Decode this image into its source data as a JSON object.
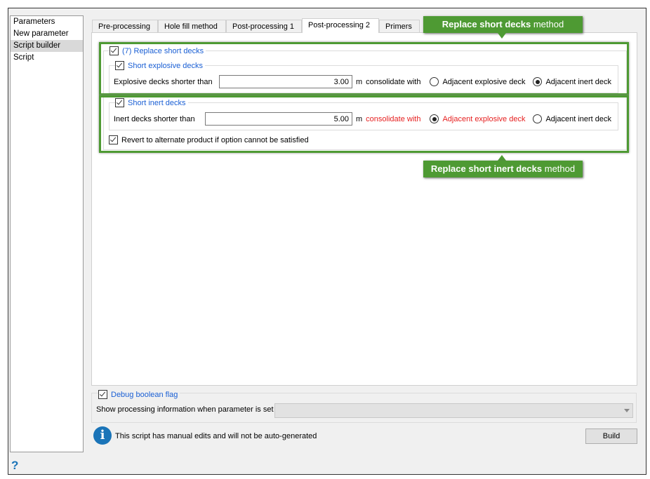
{
  "sidebar": {
    "items": [
      {
        "label": "Parameters"
      },
      {
        "label": "New parameter"
      },
      {
        "label": "Script builder"
      },
      {
        "label": "Script"
      }
    ]
  },
  "tabs": [
    {
      "label": "Pre-processing"
    },
    {
      "label": "Hole fill method"
    },
    {
      "label": "Post-processing 1"
    },
    {
      "label": "Post-processing 2"
    },
    {
      "label": "Primers"
    }
  ],
  "replace_group": {
    "label": "(7) Replace short decks"
  },
  "explosive": {
    "group_label": "Short explosive decks",
    "field_label": "Explosive decks shorter than",
    "value": "3.00",
    "unit": "m",
    "consolidate": "consolidate with",
    "opt1": "Adjacent explosive deck",
    "opt2": "Adjacent inert deck",
    "selected": "opt2"
  },
  "inert": {
    "group_label": "Short inert decks",
    "field_label": "Inert decks shorter than",
    "value": "5.00",
    "unit": "m",
    "consolidate": "consolidate with",
    "opt1": "Adjacent explosive deck",
    "opt2": "Adjacent inert deck",
    "selected": "opt1"
  },
  "revert_label": "Revert to alternate product if option cannot be satisfied",
  "callouts": {
    "top_bold": "Replace short decks",
    "top_rest": " method",
    "bottom_bold": "Replace short inert decks",
    "bottom_rest": " method"
  },
  "debug": {
    "label": "Debug boolean flag",
    "field_label": "Show processing information when parameter is set",
    "value": ""
  },
  "info_text": "This script has manual edits and will not be auto-generated",
  "build_label": "Build",
  "help_glyph": "?",
  "colors": {
    "accent": "#4e9a33",
    "link": "#1a5fd4",
    "warning": "#e62020"
  }
}
